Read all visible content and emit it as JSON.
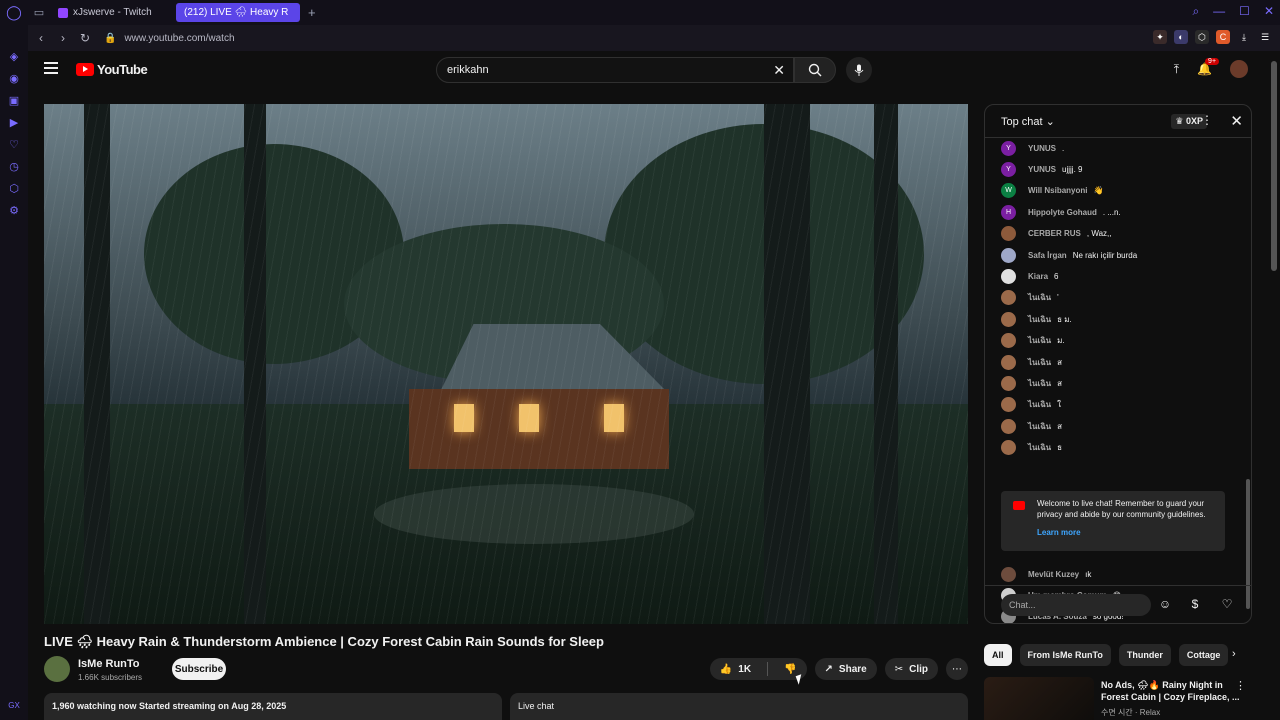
{
  "browser": {
    "tabs": [
      {
        "label": "xJswerve - Twitch"
      },
      {
        "label": "(212) LIVE 🌧 Heavy R"
      }
    ],
    "url": "www.youtube.com/watch",
    "sidebar_bottom_label": "GX"
  },
  "youtube": {
    "logo_text": "YouTube",
    "search": {
      "value": "erikkahn"
    },
    "notification_count": "9+",
    "video": {
      "title": "LIVE 🌧 Heavy Rain & Thunderstorm Ambience | Cozy Forest Cabin Rain Sounds for Sleep",
      "channel_name": "IsMe RunTo",
      "subscribers": "1.66K subscribers",
      "subscribe_label": "Subscribe",
      "like_count": "1K",
      "share_label": "Share",
      "clip_label": "Clip",
      "description_meta": "1,960 watching now  Started streaming on Aug 28, 2025",
      "live_chat_label": "Live chat"
    },
    "chat": {
      "header_label": "Top chat",
      "xp_label": "0XP",
      "messages": [
        {
          "initial": "Y",
          "author": "YUNUS",
          "text": ".",
          "color": "#7b1fa2"
        },
        {
          "initial": "Y",
          "author": "YUNUS",
          "text": "ujjjj. 9",
          "color": "#7b1fa2"
        },
        {
          "initial": "W",
          "author": "Will Nsibanyoni",
          "text": "👋",
          "color": "#0b8043"
        },
        {
          "initial": "H",
          "author": "Hippolyte Gohaud",
          "text": ". ...n.",
          "color": "#7b1fa2"
        },
        {
          "initial": "",
          "author": "CERBER RUS",
          "text": ", Waz,,",
          "color": "#8d5a3b"
        },
        {
          "initial": "",
          "author": "Safa İrgan",
          "text": "Ne rakı içilir burda",
          "color": "#9fa8c8"
        },
        {
          "initial": "",
          "author": "Kiara",
          "text": "6",
          "color": "#e0e0e0"
        },
        {
          "initial": "",
          "author": "ไนเฉิน",
          "text": "'",
          "color": "#9b6a4a"
        },
        {
          "initial": "",
          "author": "ไนเฉิน",
          "text": "ธ ม.",
          "color": "#9b6a4a"
        },
        {
          "initial": "",
          "author": "ไนเฉิน",
          "text": "ม.",
          "color": "#9b6a4a"
        },
        {
          "initial": "",
          "author": "ไนเฉิน",
          "text": "ส",
          "color": "#9b6a4a"
        },
        {
          "initial": "",
          "author": "ไนเฉิน",
          "text": "ส",
          "color": "#9b6a4a"
        },
        {
          "initial": "",
          "author": "ไนเฉิน",
          "text": "ใ",
          "color": "#9b6a4a"
        },
        {
          "initial": "",
          "author": "ไนเฉิน",
          "text": "ส",
          "color": "#9b6a4a"
        },
        {
          "initial": "",
          "author": "ไนเฉิน",
          "text": "ธ",
          "color": "#9b6a4a"
        }
      ],
      "welcome_text": "Welcome to live chat! Remember to guard your privacy and abide by our community guidelines.",
      "learn_more": "Learn more",
      "after_messages": [
        {
          "initial": "",
          "author": "Mevlüt Kuzey",
          "text": "ık",
          "color": "#6d4c3d"
        },
        {
          "initial": "",
          "author": "Um membro Comum",
          "text": "😊",
          "color": "#cfcfcf"
        },
        {
          "initial": "",
          "author": "Lucas A. Souza",
          "text": "so good!",
          "color": "#8a8a8a"
        }
      ],
      "input_placeholder": "Chat..."
    },
    "chips": [
      "All",
      "From IsMe RunTo",
      "Thunder",
      "Cottage"
    ],
    "recommendation": {
      "title": "No Ads, 🌧🔥 Rainy Night in Forest Cabin | Cozy Fireplace, ...",
      "meta": "수면 시간 · Relax"
    }
  }
}
